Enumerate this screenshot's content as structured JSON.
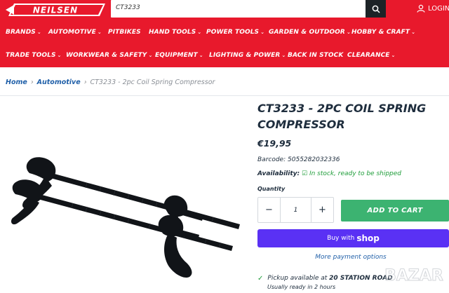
{
  "brand": {
    "logo_text": "NEILSEN",
    "color": "#e8192c"
  },
  "search": {
    "value": "CT3233",
    "icon": "search-icon"
  },
  "account": {
    "label": "LOGIN",
    "icon": "user-icon"
  },
  "nav": {
    "row1": [
      {
        "label": "BRANDS",
        "chevron": true
      },
      {
        "label": "AUTOMOTIVE",
        "chevron": true
      },
      {
        "label": "PITBIKES",
        "chevron": false
      },
      {
        "label": "HAND TOOLS",
        "chevron": true
      },
      {
        "label": "POWER TOOLS",
        "chevron": true
      },
      {
        "label": "GARDEN & OUTDOOR",
        "chevron": true
      },
      {
        "label": "HOBBY & CRAFT",
        "chevron": true
      }
    ],
    "row2": [
      {
        "label": "TRADE TOOLS",
        "chevron": true
      },
      {
        "label": "WORKWEAR & SAFETY",
        "chevron": true
      },
      {
        "label": "EQUIPMENT",
        "chevron": true
      },
      {
        "label": "LIGHTING & POWER",
        "chevron": true
      },
      {
        "label": "BACK IN STOCK",
        "chevron": false
      },
      {
        "label": "CLEARANCE",
        "chevron": true
      }
    ]
  },
  "breadcrumb": {
    "home": "Home",
    "category": "Automotive",
    "current": "CT3233 - 2pc Coil Spring Compressor"
  },
  "product": {
    "title": "CT3233 - 2PC COIL SPRING COMPRESSOR",
    "price": "€19,95",
    "barcode_label": "Barcode:",
    "barcode": "5055282032336",
    "availability_label": "Availability:",
    "availability_status": "In stock, ready to be shipped",
    "quantity_label": "Quantity",
    "quantity": "1",
    "minus": "−",
    "plus": "+",
    "add_to_cart": "ADD TO CART",
    "buy_with": "Buy with",
    "shop": "shop",
    "more_payment": "More payment options",
    "pickup_prefix": "Pickup available at",
    "pickup_location": "20 STATION ROAD",
    "pickup_time": "Usually ready in 2 hours"
  },
  "watermark": "BAZAR",
  "colors": {
    "accent_red": "#e8192c",
    "cart_green": "#3cb371",
    "shop_purple": "#5a31f4",
    "link_blue": "#1f5fa8",
    "stock_green": "#1f9d3a"
  }
}
